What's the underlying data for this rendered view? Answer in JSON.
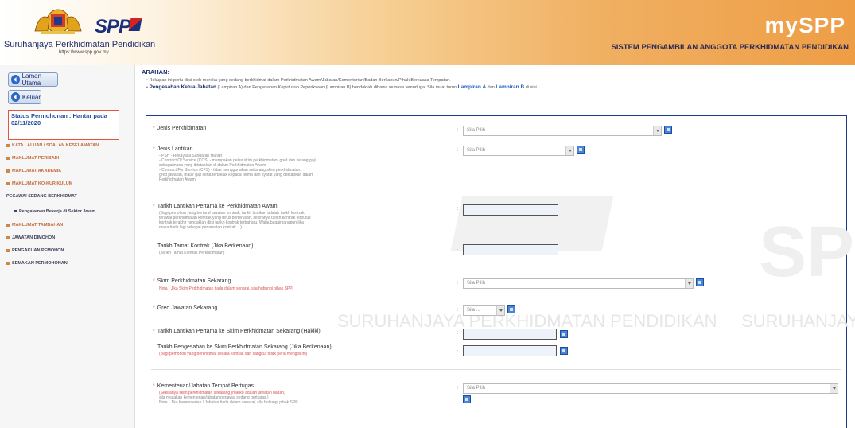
{
  "header": {
    "logo_text": "SPP",
    "org_name": "Suruhanjaya Perkhidmatan Pendidikan",
    "org_url": "https://www.spp.gov.my",
    "app_name": "mySPP",
    "app_fullname": "SISTEM PENGAMBILAN ANGGOTA PERKHIDMATAN PENDIDIKAN"
  },
  "sidebar": {
    "home_label": "Laman Utama",
    "logout_label": "Keluar",
    "status_text": "Status Permohonan : Hantar pada 02/11/2020",
    "menu": [
      "KATA LALUAN / SOALAN KESELAMATAN",
      "MAKLUMAT PERIBADI",
      "MAKLUMAT AKADEMIK",
      "MAKLUMAT KO-KURIKULUM",
      "PEGAWAI SEDANG BERKHIDMAT",
      "Pengalaman Bekerja di Sektor Awam",
      "MAKLUMAT TAMBAHAN",
      "JAWATAN DIMOHON",
      "PENGAKUAN PEMOHON",
      "SEMAKAN PERMOHONAN"
    ]
  },
  "main": {
    "arahan_title": "ARAHAN:",
    "arahan_1": "Rekupan ini perlu diisi oleh mereka yang sedang berkhidmat dalam Perkhidmatan Awam/Jabatan/Kementerian/Badan Berkanun/Pihak Berkuasa Tempatan.",
    "arahan_2_bold": "Pengesahan Ketua Jabatan",
    "arahan_2": "(Lampiran A) dan Pengesahan Keputusan Peperiksaan (Lampiran B) hendaklah dibawa semasa temuduga. Sila muat turun",
    "lampiran_a": "Lampiran A",
    "and": "dan",
    "lampiran_b": "Lampiran B",
    "arahan_2_end": "di sini.",
    "select_placeholder": "Sila Pilih",
    "select_short_placeholder": "Sila ...",
    "watermark": "SURUHANJAYA PERKHIDMATAN PENDIDIKAN",
    "watermark_2": "SURUHANJAYA PE",
    "watermark_3": "SP",
    "fields": {
      "jenis_perkhidmatan": "Jenis Perkhidmatan",
      "jenis_lantikan": "Jenis Lantikan",
      "jenis_lantikan_notes": [
        "- PSH - Rekayasa Sandaran Harian",
        "- Contract Of Service (COS) - merupakan pelan skim perkhidmatan, gred dan bidang gaji",
        "  sebagaimana yang ditetapkan di dalam Perkhidmatan Awam.",
        "- Contract For Service (CFS) - tidak menggunakan sebarang skim perkhidmatan,",
        "  gred jawatan, malar gaji serta tertakluk kepada terma dan syarat yang ditetapkan dalam",
        "  Perkhidmatan Awam."
      ],
      "tarikh_lantikan": "Tarikh Lantikan Pertama ke Perkhidmatan Awam",
      "tarikh_lantikan_notes": [
        "(Bagi pemohon yang bertaraf jawatan kontrak, tarikh lantikan adalah tarikh kontrak",
        "terawal perkhidmatan kontrak yang terus berterusan, sekiranya tarikh kontrak terputus",
        "kontrak terakhir hendaklah diisi tarikh kontrak terbaharu. Walaubagaimanapun jika",
        "maka tiada lagi sebagai penamatan kontrak ...)"
      ],
      "tarikh_tamat": "Tarikh Tamat Kontrak (Jika Berkenaan)",
      "tarikh_tamat_note": "(Tarikh Tamat Kontrak Perkhidmatan)",
      "skim": "Skim Perkhidmatan Sekarang",
      "skim_note": "Nota : Jika Skim Perkhidmatan tiada dalam senarai, sila hubungi pihak SPP.",
      "gred": "Gred Jawatan Sekarang",
      "tarikh_skim": "Tarikh Lantikan Pertama ke Skim Perkhidmatan Sekarang (Hakiki)",
      "tarikh_sah": "Tarikh Pengesahan ke Skim Perkhidmatan Sekarang (Jika Berkenaan)",
      "tarikh_sah_note": "(Bagi pemohon yang berkhidmat secara kontrak dan sangkut tidak perlu mengisi ini)",
      "kementerian": "Kementerian/Jabatan Tempat Bertugas",
      "kementerian_notes": [
        "(Sekiranya skim perkhidmatan sekarang (hakiki) adalah jawatan badan,",
        "sila nyatakan kementerian/jabatan pegawai sedang bertugas.)",
        "Nota : Jika Kementerian / Jabatan tiada dalam senarai, sila hubungi pihak SPP."
      ]
    }
  }
}
